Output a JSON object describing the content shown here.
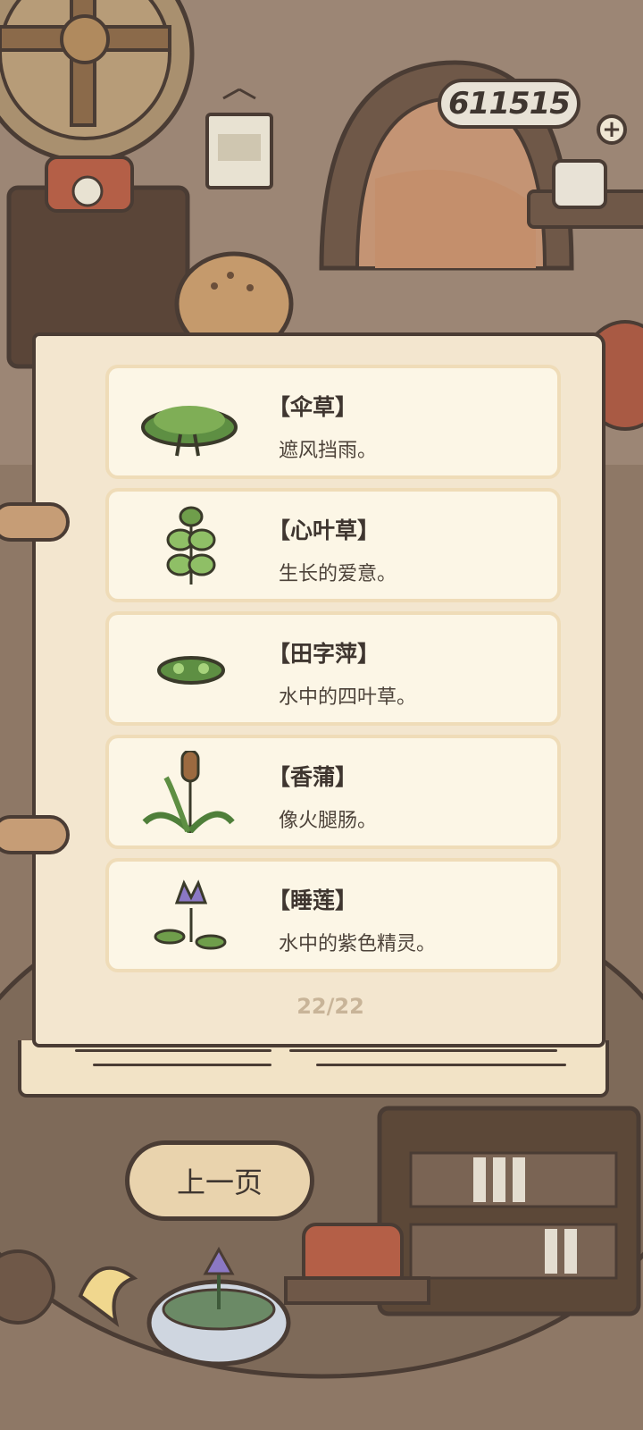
{
  "hud": {
    "clover_count": "611515",
    "plus_symbol": "+"
  },
  "book": {
    "items": [
      {
        "name": "【伞草】",
        "desc": "遮风挡雨。",
        "icon": "umbrella-grass-icon"
      },
      {
        "name": "【心叶草】",
        "desc": "生长的爱意。",
        "icon": "heart-leaf-grass-icon"
      },
      {
        "name": "【田字萍】",
        "desc": "水中的四叶草。",
        "icon": "water-clover-icon"
      },
      {
        "name": "【香蒲】",
        "desc": "像火腿肠。",
        "icon": "cattail-icon"
      },
      {
        "name": "【睡莲】",
        "desc": "水中的紫色精灵。",
        "icon": "water-lily-icon"
      }
    ],
    "page_indicator": "22/22"
  },
  "nav": {
    "prev_label": "上一页"
  }
}
